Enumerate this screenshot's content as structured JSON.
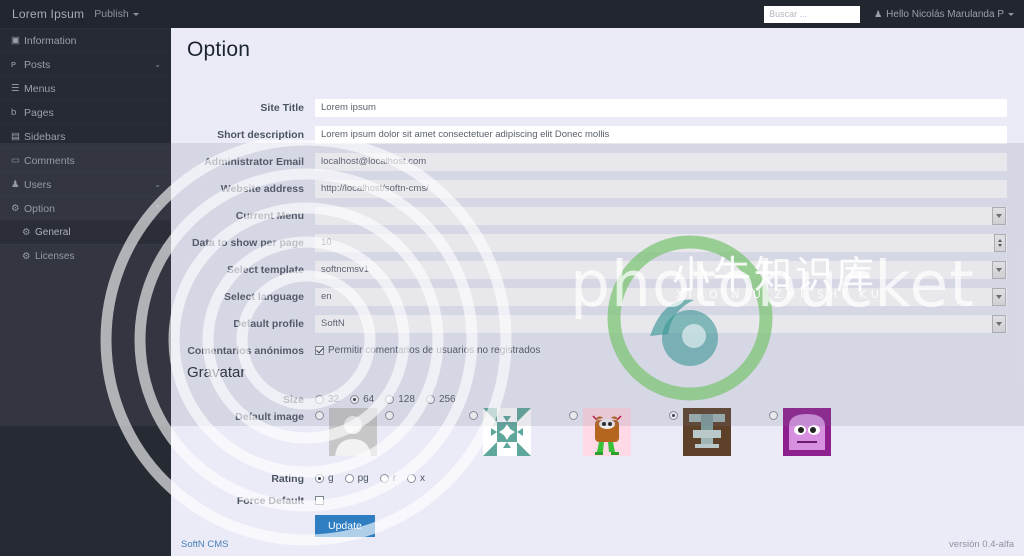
{
  "topbar": {
    "brand": "Lorem Ipsum",
    "publish_label": "Publish",
    "search_placeholder": "Buscar ...",
    "user_greeting": "Hello Nicolás Marulanda P"
  },
  "sidebar": {
    "items": [
      {
        "label": "Information",
        "icon": "info-icon",
        "glyph": "▣",
        "chevron": "",
        "sub": false,
        "active": false
      },
      {
        "label": "Posts",
        "icon": "megaphone-icon",
        "glyph": "ᴘ",
        "chevron": "⌄",
        "sub": false,
        "active": false
      },
      {
        "label": "Menus",
        "icon": "list-icon",
        "glyph": "☰",
        "chevron": "",
        "sub": false,
        "active": false
      },
      {
        "label": "Pages",
        "icon": "page-icon",
        "glyph": "὜b",
        "chevron": "",
        "sub": false,
        "active": false
      },
      {
        "label": "Sidebars",
        "icon": "sidebar-icon",
        "glyph": "▤",
        "chevron": "",
        "sub": false,
        "active": false
      },
      {
        "label": "Comments",
        "icon": "comment-icon",
        "glyph": "▭",
        "chevron": "",
        "sub": false,
        "active": false
      },
      {
        "label": "Users",
        "icon": "user-icon",
        "glyph": "♟",
        "chevron": "⌄",
        "sub": false,
        "active": false
      },
      {
        "label": "Option",
        "icon": "gear-icon",
        "glyph": "⚙",
        "chevron": "⌃",
        "sub": false,
        "active": false
      },
      {
        "label": "General",
        "icon": "gear-icon",
        "glyph": "⚙",
        "chevron": "",
        "sub": true,
        "active": true
      },
      {
        "label": "Licenses",
        "icon": "gear-icon",
        "glyph": "⚙",
        "chevron": "",
        "sub": true,
        "active": false
      }
    ]
  },
  "main": {
    "page_title": "Option",
    "gravatar_title": "Gravatar",
    "fields": [
      {
        "label": "Site Title",
        "value": "Lorem ipsum",
        "type": "text"
      },
      {
        "label": "Short description",
        "value": "Lorem ipsum dolor sit amet consectetuer adipiscing elit Donec mollis",
        "type": "text"
      },
      {
        "label": "Administrator Email",
        "value": "localhost@localhost.com",
        "type": "text"
      },
      {
        "label": "Website address",
        "value": "http://localhost/softn-cms/",
        "type": "text"
      },
      {
        "label": "Current Menu",
        "value": "",
        "type": "select"
      },
      {
        "label": "Data to show per page",
        "value": "10",
        "type": "number"
      },
      {
        "label": "Select template",
        "value": "softncmsv1",
        "type": "select"
      },
      {
        "label": "Select language",
        "value": "en",
        "type": "select"
      },
      {
        "label": "Default profile",
        "value": "SoftN",
        "type": "select"
      }
    ],
    "anonymous_comments": {
      "label": "Comentarios anónimos",
      "checkbox_label": "Permitir comentarios de usuarios no registrados",
      "checked": true
    },
    "gravatar": {
      "size": {
        "label": "Size",
        "options": [
          "32",
          "64",
          "128",
          "256"
        ],
        "selected": "64"
      },
      "default_image": {
        "label": "Default image",
        "options": [
          {
            "name": "mm",
            "selected": false
          },
          {
            "name": "blank",
            "selected": false
          },
          {
            "name": "identicon",
            "selected": false
          },
          {
            "name": "monsterid",
            "selected": false
          },
          {
            "name": "wavatar",
            "selected": true
          },
          {
            "name": "retro",
            "selected": false
          }
        ]
      },
      "rating": {
        "label": "Rating",
        "options": [
          "g",
          "pg",
          "r",
          "x"
        ],
        "selected": "g"
      },
      "force_default": {
        "label": "Force Default",
        "checked": false
      }
    },
    "update_button": "Update"
  },
  "footer": {
    "link": "SoftN CMS",
    "version": "versión 0.4-alfa"
  },
  "watermark": {
    "text": "photobucket",
    "chinese": "小牛知识库",
    "pinyin": "XIAO NIU ZHI SHI KU"
  },
  "colors": {
    "accent": "#2e7ec1",
    "sidebar_bg": "#262a32",
    "topbar_bg": "#22262e",
    "content_bg": "#eaebf7",
    "link": "#4a7fb5"
  }
}
